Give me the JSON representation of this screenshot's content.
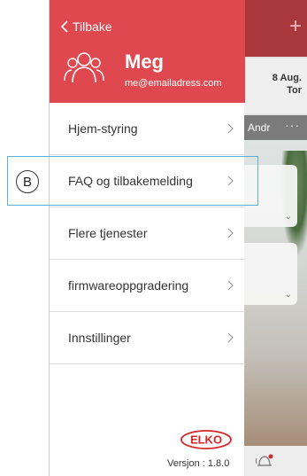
{
  "drawer": {
    "back_label": "Tilbake",
    "user": {
      "name": "Meg",
      "email": "me@emailadress.com"
    },
    "menu_items": [
      {
        "label": "Hjem-styring"
      },
      {
        "label": "FAQ og tilbakemelding"
      },
      {
        "label": "Flere tjenester"
      },
      {
        "label": "firmwareoppgradering"
      },
      {
        "label": "Innstillinger"
      }
    ],
    "logo_text": "ELKO",
    "version": "Versjon : 1.8.0"
  },
  "annotation": {
    "callout_letter": "B"
  },
  "background_app": {
    "plus_icon": "+",
    "date_line1": "8 Aug.",
    "date_line2": "Tor",
    "room_label": "Andr",
    "more_dots": "···"
  },
  "colors": {
    "header_red": "#e0484f",
    "highlight_blue": "#5ab0d9"
  }
}
